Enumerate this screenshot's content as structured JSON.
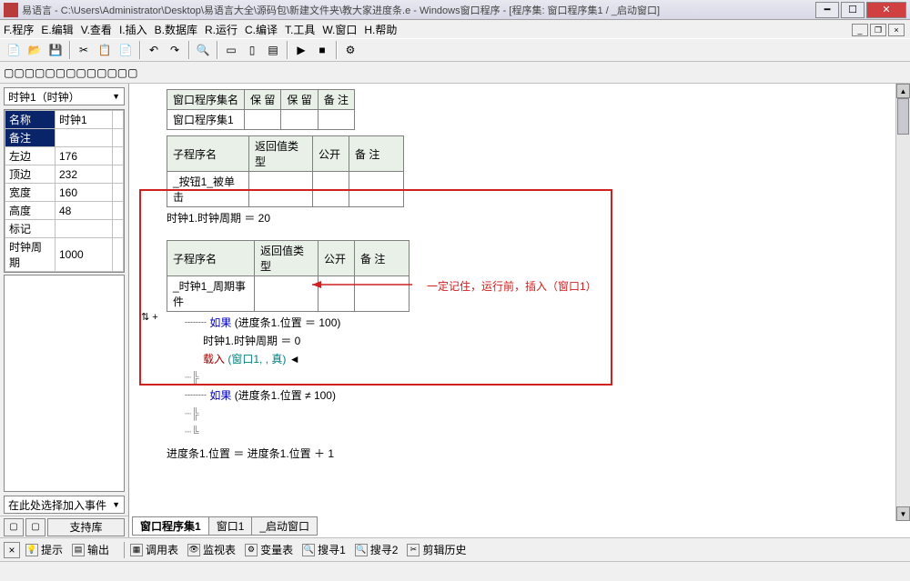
{
  "window": {
    "title": "易语言 - C:\\Users\\Administrator\\Desktop\\易语言大全\\源码包\\新建文件夹\\教大家进度条.e - Windows窗口程序 - [程序集: 窗口程序集1 / _启动窗口]"
  },
  "menu": {
    "items": [
      "F.程序",
      "E.编辑",
      "V.查看",
      "I.插入",
      "B.数据库",
      "R.运行",
      "C.编译",
      "T.工具",
      "W.窗口",
      "H.帮助"
    ]
  },
  "properties": {
    "combo": "时钟1（时钟）",
    "rows": [
      {
        "name": "名称",
        "value": "时钟1",
        "sel": true
      },
      {
        "name": "备注",
        "value": "",
        "sel": true
      },
      {
        "name": "左边",
        "value": "176"
      },
      {
        "name": "顶边",
        "value": "232"
      },
      {
        "name": "宽度",
        "value": "160"
      },
      {
        "name": "高度",
        "value": "48"
      },
      {
        "name": "标记",
        "value": ""
      },
      {
        "name": "时钟周期",
        "value": "1000"
      }
    ],
    "event_combo": "在此处选择加入事件"
  },
  "leftfoot": {
    "support": "支持库"
  },
  "editor": {
    "table1": {
      "headers": [
        "窗口程序集名",
        "保 留",
        "保 留",
        "备 注"
      ],
      "row": [
        "窗口程序集1",
        "",
        "",
        ""
      ]
    },
    "table2": {
      "headers": [
        "子程序名",
        "返回值类型",
        "公开",
        "备 注"
      ],
      "row": [
        "_按钮1_被单击",
        "",
        "",
        ""
      ]
    },
    "line_period": "时钟1.时钟周期 ＝ 20",
    "table3": {
      "headers": [
        "子程序名",
        "返回值类型",
        "公开",
        "备 注"
      ],
      "row": [
        "_时钟1_周期事件",
        "",
        "",
        ""
      ]
    },
    "code": {
      "if1_pre": "如果 ",
      "if1_cond": "(进度条1.位置 ＝ 100)",
      "line2": "时钟1.时钟周期 ＝ 0",
      "line3_pre": "载入 ",
      "line3_args": "(窗口1, , 真)",
      "if2_pre": "如果 ",
      "if2_cond": "(进度条1.位置 ≠ 100)",
      "line_last": "进度条1.位置 ＝ 进度条1.位置 ＋ 1"
    },
    "annotation": "一定记住，运行前，插入（窗口1）",
    "tabs": [
      {
        "label": "窗口程序集1",
        "active": true
      },
      {
        "label": "窗口1",
        "active": false
      },
      {
        "label": "_启动窗口",
        "active": false
      }
    ]
  },
  "bottom_tabs": [
    "提示",
    "输出",
    "调用表",
    "监视表",
    "变量表",
    "搜寻1",
    "搜寻2",
    "剪辑历史"
  ]
}
